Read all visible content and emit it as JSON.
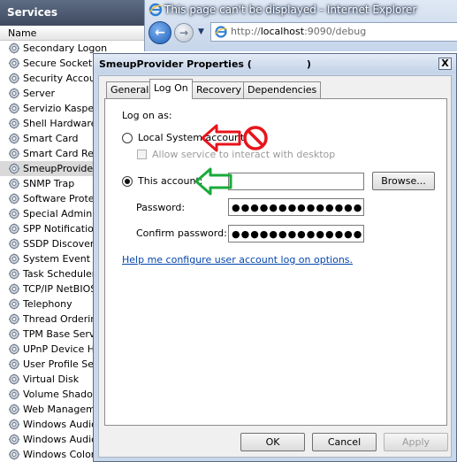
{
  "services": {
    "title": "Services",
    "column_header": "Name",
    "rows": [
      "Secondary Logon",
      "Secure Socket Tu",
      "Security Account",
      "Server",
      "Servizio Kaspersk",
      "Shell Hardware D",
      "Smart Card",
      "Smart Card Remo",
      "SmeupProvider",
      "SNMP Trap",
      "Software Protect",
      "Special Administr",
      "SPP Notification S",
      "SSDP Discovery",
      "System Event No",
      "Task Scheduler",
      "TCP/IP NetBIOS",
      "Telephony",
      "Thread Ordering",
      "TPM Base Service",
      "UPnP Device Hos",
      "User Profile Serv",
      "Virtual Disk",
      "Volume Shadow C",
      "Web Managemen",
      "Windows Audio",
      "Windows Audio E",
      "Windows Color S"
    ],
    "selected_row": "SmeupProvider"
  },
  "browser": {
    "title": "This page can't be displayed - Internet Explorer",
    "address_prefix": "http://",
    "address_host": "localhost",
    "address_suffix": ":9090/debug"
  },
  "dialog": {
    "title": "SmeupProvider Properties (",
    "title_close_paren": ")",
    "close_glyph": "X",
    "tabs": [
      "General",
      "Log On",
      "Recovery",
      "Dependencies"
    ],
    "active_tab": "Log On",
    "logon_as_label": "Log on as:",
    "local_system_label": "Local System account",
    "interact_desktop_label": "Allow service to interact with desktop",
    "this_account_label": "This account:",
    "this_account_value": "",
    "browse_label": "Browse...",
    "password_label": "Password:",
    "password_value": "●●●●●●●●●●●●●●●",
    "confirm_password_label": "Confirm password:",
    "confirm_password_value": "●●●●●●●●●●●●●●●",
    "help_link": "Help me configure user account log on options.",
    "ok_label": "OK",
    "cancel_label": "Cancel",
    "apply_label": "Apply"
  },
  "annotations": {
    "red_arrow_color": "#e8141b",
    "prohibited_icon": "prohibited-icon",
    "green_arrow_color": "#1aaa3a"
  }
}
